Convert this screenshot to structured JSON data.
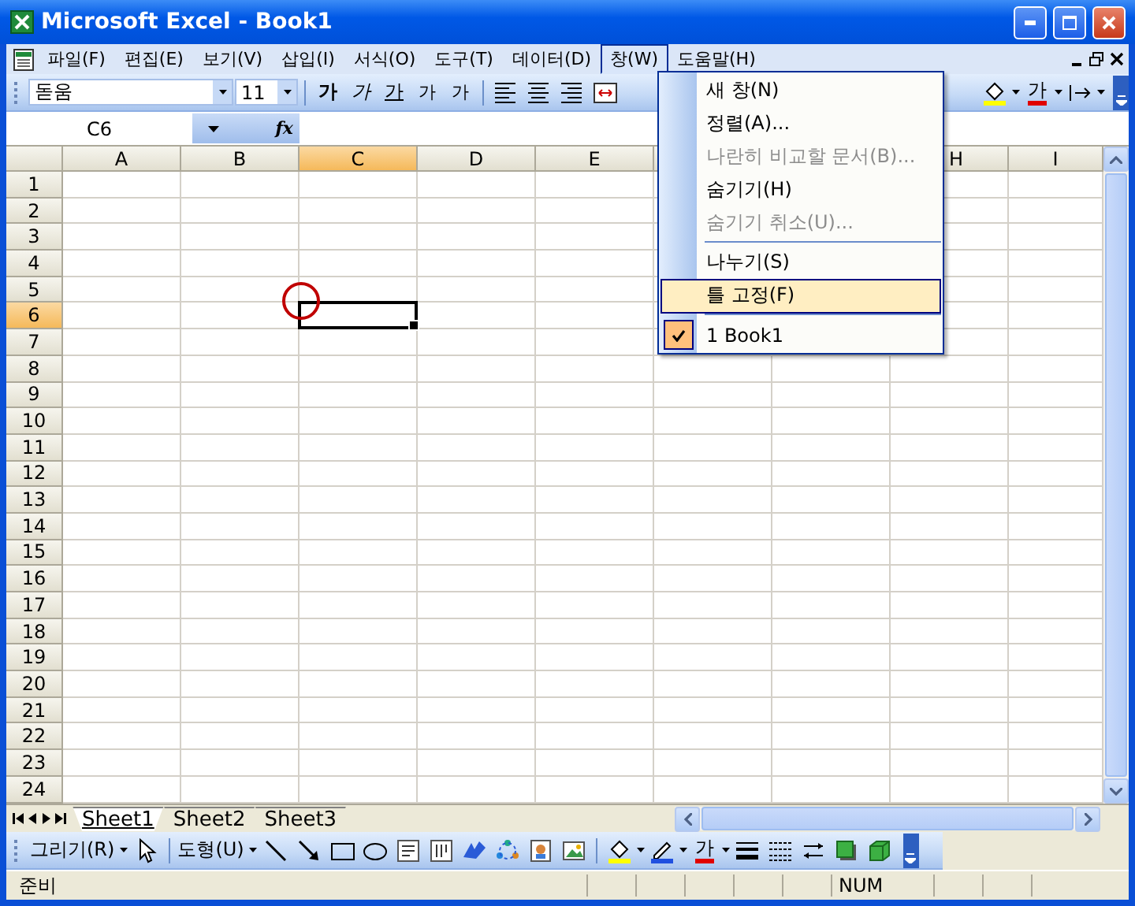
{
  "window": {
    "title": "Microsoft Excel - Book1"
  },
  "menu_bar": [
    {
      "label": "파일(F)",
      "selected": false
    },
    {
      "label": "편집(E)",
      "selected": false
    },
    {
      "label": "보기(V)",
      "selected": false
    },
    {
      "label": "삽입(I)",
      "selected": false
    },
    {
      "label": "서식(O)",
      "selected": false
    },
    {
      "label": "도구(T)",
      "selected": false
    },
    {
      "label": "데이터(D)",
      "selected": false
    },
    {
      "label": "창(W)",
      "selected": true
    },
    {
      "label": "도움말(H)",
      "selected": false
    }
  ],
  "format_toolbar": {
    "font": "돋움",
    "size": "11",
    "text_buttons": [
      {
        "kind": "bold",
        "label": "가"
      },
      {
        "kind": "italic",
        "label": "가"
      },
      {
        "kind": "underline",
        "label": "가"
      },
      {
        "kind": "grow",
        "label": "가"
      },
      {
        "kind": "shrink",
        "label": "가"
      }
    ],
    "font_color": "가"
  },
  "formula_bar": {
    "name_box": "C6",
    "function_label": "fx"
  },
  "sheet": {
    "columns": [
      {
        "label": "A",
        "selected": false
      },
      {
        "label": "B",
        "selected": false
      },
      {
        "label": "C",
        "selected": true
      },
      {
        "label": "D",
        "selected": false
      },
      {
        "label": "E",
        "selected": false
      },
      {},
      {},
      {
        "label": "H",
        "selected": false
      },
      {
        "label": "I",
        "selected": false
      }
    ],
    "rows": [
      {
        "label": "1",
        "selected": false
      },
      {
        "label": "2",
        "selected": false
      },
      {
        "label": "3",
        "selected": false
      },
      {
        "label": "4",
        "selected": false
      },
      {
        "label": "5",
        "selected": false
      },
      {
        "label": "6",
        "selected": true
      },
      {
        "label": "7",
        "selected": false
      },
      {
        "label": "8",
        "selected": false
      },
      {
        "label": "9",
        "selected": false
      },
      {
        "label": "10",
        "selected": false
      },
      {
        "label": "11",
        "selected": false
      },
      {
        "label": "12",
        "selected": false
      },
      {
        "label": "13",
        "selected": false
      },
      {
        "label": "14",
        "selected": false
      },
      {
        "label": "15",
        "selected": false
      },
      {
        "label": "16",
        "selected": false
      },
      {
        "label": "17",
        "selected": false
      },
      {
        "label": "18",
        "selected": false
      },
      {
        "label": "19",
        "selected": false
      },
      {
        "label": "20",
        "selected": false
      },
      {
        "label": "21",
        "selected": false
      },
      {
        "label": "22",
        "selected": false
      },
      {
        "label": "23",
        "selected": false
      },
      {
        "label": "24",
        "selected": false
      }
    ]
  },
  "window_menu": {
    "items": [
      {
        "kind": "item",
        "label": "새 창(N)",
        "disabled": false,
        "highlighted": false,
        "checked": false
      },
      {
        "kind": "item",
        "label": "정렬(A)...",
        "disabled": false,
        "highlighted": false,
        "checked": false
      },
      {
        "kind": "item",
        "label": "나란히 비교할 문서(B)...",
        "disabled": true,
        "highlighted": false,
        "checked": false
      },
      {
        "kind": "item",
        "label": "숨기기(H)",
        "disabled": false,
        "highlighted": false,
        "checked": false
      },
      {
        "kind": "item",
        "label": "숨기기 취소(U)...",
        "disabled": true,
        "highlighted": false,
        "checked": false
      },
      {
        "kind": "separator"
      },
      {
        "kind": "item",
        "label": "나누기(S)",
        "disabled": false,
        "highlighted": false,
        "checked": false
      },
      {
        "kind": "item",
        "label": "틀 고정(F)",
        "disabled": false,
        "highlighted": true,
        "checked": false
      },
      {
        "kind": "separator"
      },
      {
        "kind": "item",
        "label": "1 Book1",
        "disabled": false,
        "highlighted": false,
        "checked": true
      }
    ]
  },
  "sheet_tabs": [
    {
      "label": "Sheet1",
      "selected": true
    },
    {
      "label": "Sheet2",
      "selected": false
    },
    {
      "label": "Sheet3",
      "selected": false
    }
  ],
  "drawing_toolbar": {
    "draw_menu": "그리기(R)",
    "shapes_menu": "도형(U)",
    "font_color": "가"
  },
  "status_bar": {
    "mode": "준비",
    "num": "NUM"
  }
}
